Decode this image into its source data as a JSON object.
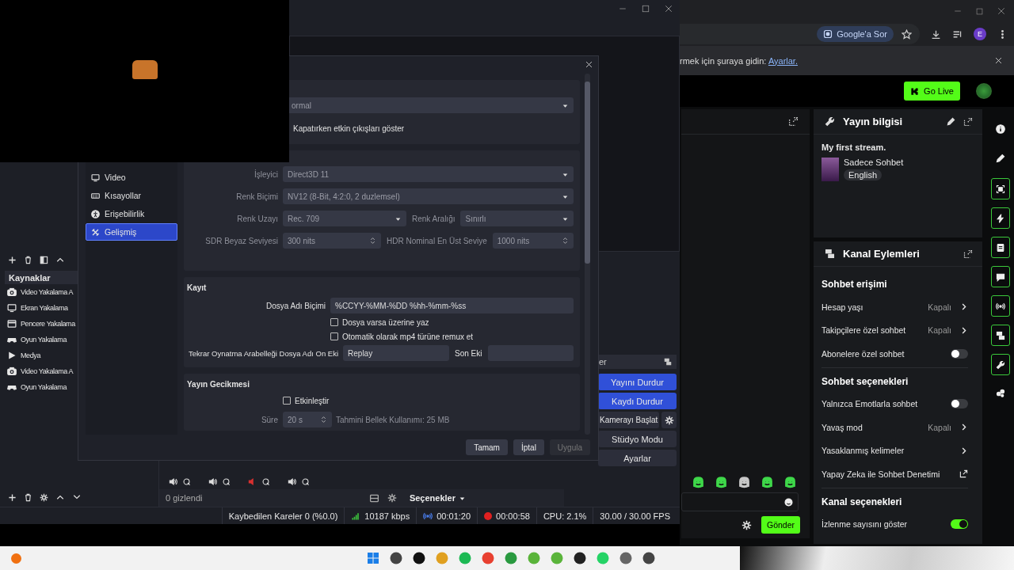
{
  "obs": {
    "sources": {
      "title": "Kaynaklar",
      "items": [
        {
          "name": "Video Yakalama A",
          "kind": "camera"
        },
        {
          "name": "Ekran Yakalama",
          "kind": "display"
        },
        {
          "name": "Pencere Yakalama",
          "kind": "window"
        },
        {
          "name": "Oyun Yakalama",
          "kind": "game"
        },
        {
          "name": "Medya",
          "kind": "media"
        },
        {
          "name": "Video Yakalama A",
          "kind": "camera"
        },
        {
          "name": "Oyun Yakalama",
          "kind": "game"
        }
      ]
    },
    "mixer": {
      "channels": [
        {
          "muted": false
        },
        {
          "muted": false
        },
        {
          "muted": true
        },
        {
          "muted": false
        }
      ],
      "hidden": "0 gizlendi",
      "options": "Seçenekler"
    },
    "controls": {
      "title": "er",
      "buttons": [
        {
          "label": "Yayını Durdur",
          "active": true,
          "kind": "plain"
        },
        {
          "label": "Kaydı Durdur",
          "active": true,
          "kind": "plain"
        },
        {
          "label": "Kamerayı Başlat",
          "active": false,
          "kind": "split"
        },
        {
          "label": "Stüdyo Modu",
          "active": false,
          "kind": "plain"
        },
        {
          "label": "Ayarlar",
          "active": false,
          "kind": "plain"
        }
      ]
    },
    "status_bar": {
      "dropped_frames": "Kaybedilen Kareler 0 (%0.0)",
      "bitrate": "10187 kbps",
      "stream_time": "00:01:20",
      "record_time": "00:00:58",
      "cpu": "CPU: 2.1%",
      "fps": "30.00 / 30.00 FPS"
    }
  },
  "settings": {
    "sidebar": [
      {
        "label": "Video",
        "kind": "video",
        "selected": false
      },
      {
        "label": "Kısayollar",
        "kind": "keyboard",
        "selected": false
      },
      {
        "label": "Erişebilirlik",
        "kind": "accessibility",
        "selected": false
      },
      {
        "label": "Gelişmiş",
        "kind": "advanced",
        "selected": true
      }
    ],
    "general": {
      "dropdown": "ormal",
      "checkbox_label": "Kapatırken etkin çıkışları göster"
    },
    "video": {
      "rows": [
        {
          "kind": "select",
          "label": "İşleyici",
          "value": "Direct3D 11"
        },
        {
          "kind": "select",
          "label": "Renk Biçimi",
          "value": "NV12 (8-Bit, 4:2:0, 2 duzlemsel)"
        },
        {
          "kind": "select_pair",
          "label": "Renk Uzayı",
          "value": "Rec. 709",
          "label2": "Renk Aralığı",
          "value2": "Sınırlı"
        },
        {
          "kind": "spin_pair",
          "label": "SDR Beyaz Seviyesi",
          "value": "300 nits",
          "label2": "HDR Nominal En Üst Seviye",
          "value2": "1000 nits"
        }
      ]
    },
    "recording": {
      "title": "Kayıt",
      "filename_label": "Dosya Adı Biçimi",
      "filename": "%CCYY-%MM-%DD %hh-%mm-%ss",
      "checks": [
        {
          "label": "Dosya varsa üzerine yaz",
          "checked": false
        },
        {
          "label": "Otomatik olarak mp4 türüne remux et",
          "checked": false
        }
      ],
      "prefix_label": "Tekrar Oynatma Arabelleği Dosya Adı On Eki",
      "prefix": "Replay",
      "suffix_label": "Son Eki"
    },
    "delay": {
      "title": "Yayın Gecikmesi",
      "enable": {
        "label": "Etkinleştir",
        "checked": false
      },
      "duration_label": "Süre",
      "duration": "20 s",
      "memory": "Tahmini Bellek Kullanımı: 25 MB"
    },
    "buttons": [
      {
        "label": "Tamam",
        "disabled": false
      },
      {
        "label": "İptal",
        "disabled": false
      },
      {
        "label": "Uygula",
        "disabled": true
      }
    ]
  },
  "browser": {
    "ask_google": "Google'a Sor",
    "profile": "E",
    "infobar": {
      "text": "rmek için şuraya gidin: ",
      "link": "Ayarlar."
    },
    "go_live": "Go Live",
    "send": "Gönder",
    "stream_info": {
      "title": "Yayın bilgisi",
      "stream_title": "My first stream.",
      "category": "Sadece Sohbet",
      "language": "English"
    },
    "channel_actions": {
      "title": "Kanal Eylemleri",
      "sections": [
        {
          "heading": "Sohbet erişimi",
          "rows": [
            {
              "kind": "link",
              "label": "Hesap yaşı",
              "value": "Kapalı"
            },
            {
              "kind": "link",
              "label": "Takipçilere özel sohbet",
              "value": "Kapalı"
            },
            {
              "kind": "toggle",
              "label": "Abonelere özel sohbet",
              "on": false
            }
          ]
        },
        {
          "heading": "Sohbet seçenekleri",
          "rows": [
            {
              "kind": "toggle",
              "label": "Yalnızca Emotlarla sohbet",
              "on": false
            },
            {
              "kind": "link",
              "label": "Yavaş mod",
              "value": "Kapalı"
            },
            {
              "kind": "link",
              "label": "Yasaklanmış kelimeler"
            },
            {
              "kind": "external",
              "label": "Yapay Zeka ile Sohbet Denetimi"
            }
          ]
        },
        {
          "heading": "Kanal seçenekleri",
          "rows": [
            {
              "kind": "toggle",
              "label": "İzlenme sayısını göster",
              "on": true
            }
          ]
        }
      ]
    }
  }
}
